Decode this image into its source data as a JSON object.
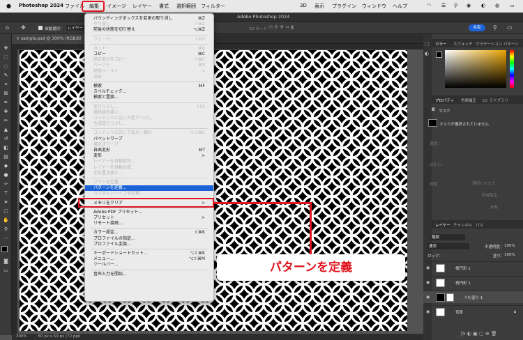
{
  "menubar": {
    "app_name": "Photoshop 2024",
    "items": [
      "ファイル",
      "編集",
      "イメージ",
      "レイヤー",
      "書式",
      "選択範囲",
      "フィルター",
      "3D",
      "表示",
      "プラグイン",
      "ウィンドウ",
      "ヘルプ"
    ]
  },
  "app_title": "Adobe Photoshop 2024",
  "options_bar": {
    "auto_select_label": "自動選択：",
    "auto_select_value": "レイヤー",
    "mode_3d": "3D モード：",
    "share_button": "共有"
  },
  "document": {
    "tab_label": "sample.psd @ 300% (RGB/8)",
    "zoom": "300%",
    "doc_info": "50 px x 50 px (72 ppi)"
  },
  "edit_menu": {
    "items": [
      {
        "label": "バウンディングボックスを変更の取り消し",
        "shortcut": "⌘Z",
        "disabled": false
      },
      {
        "label": "やり直し",
        "shortcut": "⇧⌘Z",
        "disabled": true
      },
      {
        "label": "前後の状態を切り替え",
        "shortcut": "⌥⌘Z",
        "disabled": false
      },
      {
        "sep": true
      },
      {
        "label": "フェード...",
        "shortcut": "⇧⌘F",
        "disabled": true
      },
      {
        "sep": true
      },
      {
        "label": "カット",
        "shortcut": "⌘X",
        "disabled": true
      },
      {
        "label": "コピー",
        "shortcut": "⌘C",
        "disabled": false
      },
      {
        "label": "結合部分をコピー",
        "shortcut": "⇧⌘C",
        "disabled": true
      },
      {
        "label": "ペースト",
        "shortcut": "⌘V",
        "disabled": true
      },
      {
        "label": "特殊ペースト",
        "shortcut": ">",
        "disabled": true
      },
      {
        "label": "消去",
        "shortcut": "",
        "disabled": true
      },
      {
        "sep": true
      },
      {
        "label": "検索",
        "shortcut": "⌘F",
        "disabled": false
      },
      {
        "label": "スペルチェック...",
        "shortcut": "",
        "disabled": false
      },
      {
        "label": "検索と置換...",
        "shortcut": "",
        "disabled": false
      },
      {
        "sep": true
      },
      {
        "label": "塗りつぶし...",
        "shortcut": "⇧F5",
        "disabled": true
      },
      {
        "label": "境界線を描く...",
        "shortcut": "",
        "disabled": true
      },
      {
        "label": "コンテンツに応じた塗りつぶし...",
        "shortcut": "",
        "disabled": true
      },
      {
        "label": "生成塗りつぶし...",
        "shortcut": "",
        "disabled": true
      },
      {
        "sep": true
      },
      {
        "label": "コンテンツに応じて拡大・縮小",
        "shortcut": "⌥⇧⌘C",
        "disabled": true
      },
      {
        "label": "パペットワープ",
        "shortcut": "",
        "disabled": false
      },
      {
        "label": "遠近法ワープ",
        "shortcut": "",
        "disabled": true
      },
      {
        "label": "自由変形",
        "shortcut": "⌘T",
        "disabled": false
      },
      {
        "label": "変形",
        "shortcut": ">",
        "disabled": false
      },
      {
        "label": "レイヤーを自動整列...",
        "shortcut": "",
        "disabled": true
      },
      {
        "label": "レイヤーを自動合成...",
        "shortcut": "",
        "disabled": true
      },
      {
        "label": "空を置き換え...",
        "shortcut": "",
        "disabled": true
      },
      {
        "sep": true
      },
      {
        "label": "ブラシを定義...",
        "shortcut": "",
        "disabled": true
      },
      {
        "label": "パターンを定義...",
        "shortcut": "",
        "disabled": false,
        "highlight": true
      },
      {
        "label": "カスタムシェイプを定義...",
        "shortcut": "",
        "disabled": true
      },
      {
        "sep": true
      },
      {
        "label": "メモリをクリア",
        "shortcut": ">",
        "disabled": false
      },
      {
        "sep": true
      },
      {
        "label": "Adobe PDF プリセット...",
        "shortcut": "",
        "disabled": false
      },
      {
        "label": "プリセット",
        "shortcut": ">",
        "disabled": false
      },
      {
        "label": "リモート接続...",
        "shortcut": "",
        "disabled": false
      },
      {
        "sep": true
      },
      {
        "label": "カラー設定...",
        "shortcut": "⇧⌘K",
        "disabled": false
      },
      {
        "label": "プロファイルの指定...",
        "shortcut": "",
        "disabled": false
      },
      {
        "label": "プロファイル変換...",
        "shortcut": "",
        "disabled": false
      },
      {
        "sep": true
      },
      {
        "label": "キーボードショートカット...",
        "shortcut": "⌥⇧⌘K",
        "disabled": false
      },
      {
        "label": "メニュー...",
        "shortcut": "⌥⇧⌘M",
        "disabled": false
      },
      {
        "label": "ツールバー...",
        "shortcut": "",
        "disabled": false
      },
      {
        "sep": true
      },
      {
        "label": "音声入力を開始...",
        "shortcut": "",
        "disabled": false
      }
    ]
  },
  "callout": {
    "text": "パターンを定義"
  },
  "panels": {
    "color_tabs": [
      "カラー",
      "スウォッチ",
      "グラデーション",
      "パターン"
    ],
    "props_tabs": [
      "プロパティ",
      "色調補正",
      "CC ライブラリ"
    ],
    "mask_title": "マスク",
    "mask_status": "マスクが選択されていません",
    "density": "濃度：",
    "feather": "ぼかし：",
    "adjust": "調整：",
    "select_and_mask": "選択とマスク...",
    "color_range": "色域指定...",
    "invert": "反転",
    "layer_tabs": [
      "レイヤー",
      "チャンネル",
      "パス"
    ],
    "kind_label": "種類",
    "blend_mode": "通常",
    "opacity_label": "不透明度：",
    "opacity": "100%",
    "lock_label": "ロック：",
    "fill_label": "塗り：",
    "fill": "100%",
    "layers": [
      "楕円形 1",
      "楕円形 1",
      "べた塗り 1",
      "背景"
    ]
  },
  "colors": {
    "accent": "#1b63d6",
    "annotation": "#e0141e"
  }
}
